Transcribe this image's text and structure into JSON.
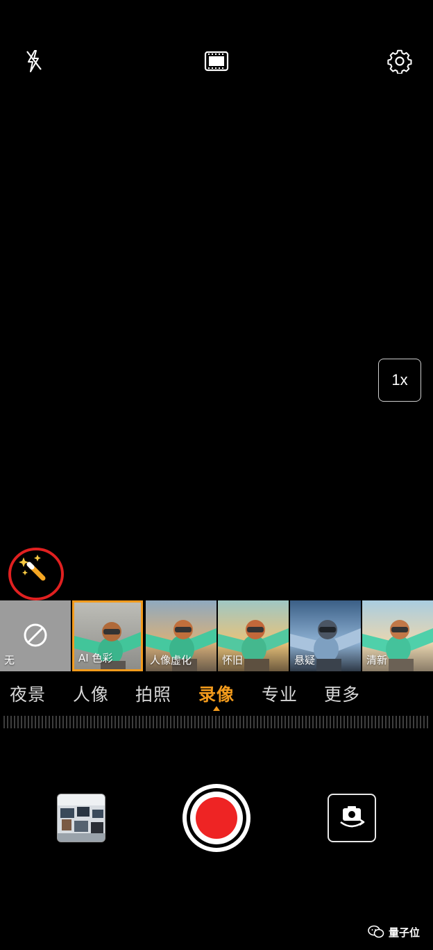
{
  "top_bar": {
    "icons": [
      "flash-off-icon",
      "film-icon",
      "gear-icon"
    ]
  },
  "zoom": {
    "label": "1x"
  },
  "ai_button": {
    "icon": "magic-wand-icon",
    "highlight_color": "#e02020"
  },
  "filters": [
    {
      "label": "无",
      "icon": "none-icon",
      "selected": false
    },
    {
      "label": "AI 色彩",
      "selected": true
    },
    {
      "label": "人像虚化",
      "selected": false
    },
    {
      "label": "怀旧",
      "selected": false
    },
    {
      "label": "悬疑",
      "selected": false
    },
    {
      "label": "清新",
      "selected": false
    }
  ],
  "modes": [
    {
      "label": "夜景",
      "active": false
    },
    {
      "label": "人像",
      "active": false
    },
    {
      "label": "拍照",
      "active": false
    },
    {
      "label": "录像",
      "active": true
    },
    {
      "label": "专业",
      "active": false
    },
    {
      "label": "更多",
      "active": false
    }
  ],
  "bottom": {
    "gallery": "gallery-thumbnail",
    "shutter": "record-button",
    "switch": "switch-camera-icon"
  },
  "colors": {
    "accent": "#f39b1c",
    "record": "#ee2424"
  },
  "watermark": {
    "text": "量子位"
  }
}
